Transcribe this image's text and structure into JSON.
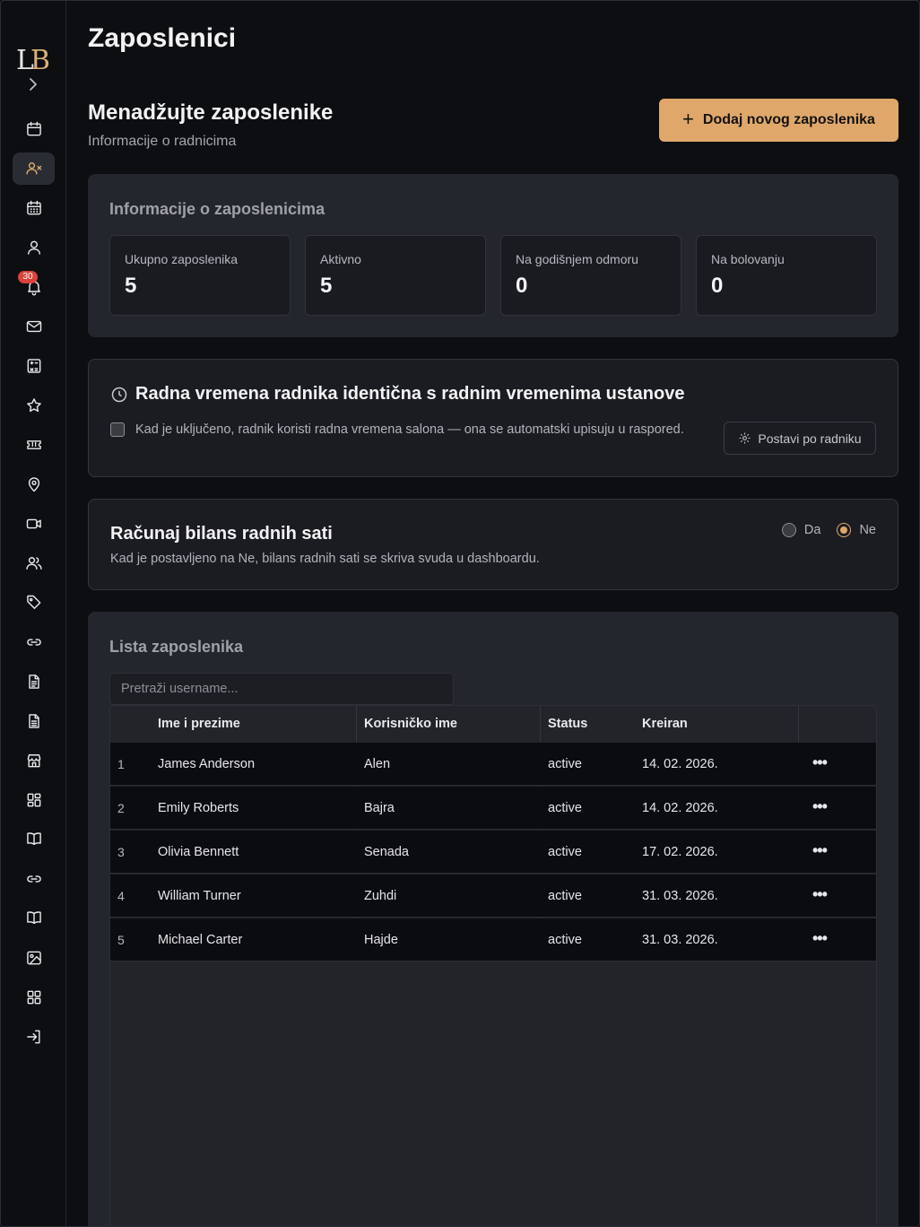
{
  "page_title": "Zaposlenici",
  "header": {
    "title": "Menadžujte zaposlenike",
    "subtitle": "Informacije o radnicima",
    "add_button_label": "Dodaj novog zaposlenika"
  },
  "sidebar": {
    "logo_text": "LB",
    "notification_count": "30",
    "items": [
      {
        "name": "calendar-icon"
      },
      {
        "name": "user-x-icon",
        "active": true
      },
      {
        "name": "calendar-grid-icon"
      },
      {
        "name": "user-icon"
      },
      {
        "name": "bell-icon"
      },
      {
        "name": "mail-icon"
      },
      {
        "name": "calculator-icon"
      },
      {
        "name": "star-icon"
      },
      {
        "name": "ticket-icon"
      },
      {
        "name": "map-pin-icon"
      },
      {
        "name": "video-icon"
      },
      {
        "name": "users-icon"
      },
      {
        "name": "tag-icon"
      },
      {
        "name": "link-icon"
      },
      {
        "name": "document-icon"
      },
      {
        "name": "document-text-icon"
      },
      {
        "name": "store-icon"
      },
      {
        "name": "dashboard-icon"
      },
      {
        "name": "book-icon"
      },
      {
        "name": "link-icon"
      },
      {
        "name": "book-open-icon"
      },
      {
        "name": "image-icon"
      },
      {
        "name": "apps-icon"
      },
      {
        "name": "logout-icon"
      }
    ]
  },
  "info": {
    "title": "Informacije o zaposlenicima",
    "stats": [
      {
        "label": "Ukupno zaposlenika",
        "value": "5"
      },
      {
        "label": "Aktivno",
        "value": "5"
      },
      {
        "label": "Na godišnjem odmoru",
        "value": "0"
      },
      {
        "label": "Na bolovanju",
        "value": "0"
      }
    ]
  },
  "working_hours": {
    "title": "Radna vremena radnika identična s radnim vremenima ustanove",
    "description": "Kad je uključeno, radnik koristi radna vremena salona — ona se automatski upisuju u raspored.",
    "checked": false,
    "button_label": "Postavi po radniku"
  },
  "balance": {
    "title": "Računaj bilans radnih sati",
    "description": "Kad je postavljeno na Ne, bilans radnih sati se skriva svuda u dashboardu.",
    "options": [
      "Da",
      "Ne"
    ],
    "selected": "Ne"
  },
  "employee_list": {
    "title": "Lista zaposlenika",
    "search_placeholder": "Pretraži username...",
    "columns": [
      "Ime i prezime",
      "Korisničko ime",
      "Status",
      "Kreiran"
    ],
    "rows": [
      {
        "num": "1",
        "name": "James Anderson",
        "username": "Alen",
        "status": "active",
        "created": "14. 02. 2026."
      },
      {
        "num": "2",
        "name": "Emily Roberts",
        "username": "Bajra",
        "status": "active",
        "created": "14. 02. 2026."
      },
      {
        "num": "3",
        "name": "Olivia Bennett",
        "username": "Senada",
        "status": "active",
        "created": "17. 02. 2026."
      },
      {
        "num": "4",
        "name": "William Turner",
        "username": "Zuhdi",
        "status": "active",
        "created": "31. 03. 2026."
      },
      {
        "num": "5",
        "name": "Michael Carter",
        "username": "Hajde",
        "status": "active",
        "created": "31. 03. 2026."
      }
    ],
    "row_menu_label": "•••"
  },
  "colors": {
    "accent": "#dfa86a",
    "background": "#0d0e12",
    "card": "#24262d",
    "badge": "#d9433b"
  }
}
